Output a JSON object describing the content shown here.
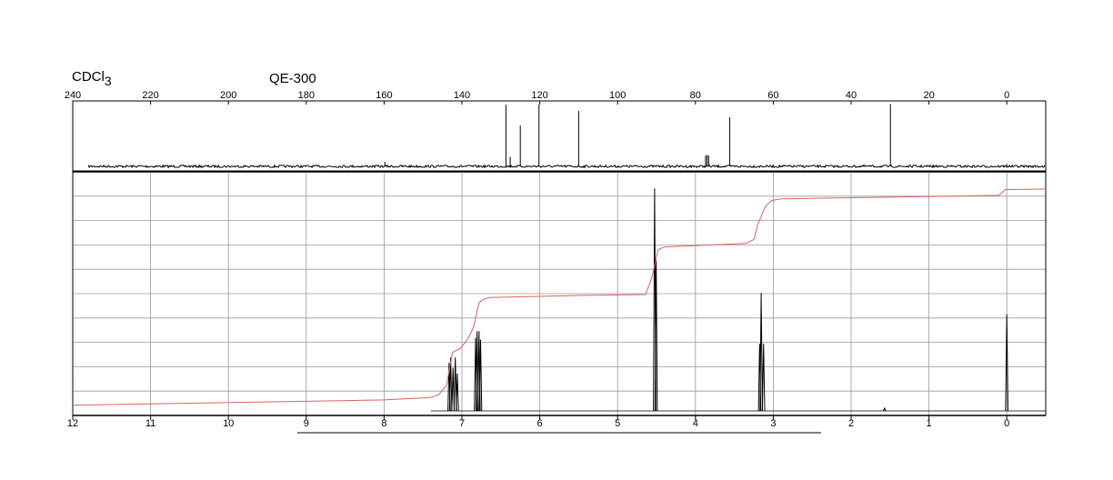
{
  "header": {
    "solvent_main": "CDCl",
    "solvent_sub": "3",
    "instrument": "QE-300"
  },
  "chart_data": [
    {
      "type": "line",
      "name": "13C NMR spectrum",
      "xlabel": "",
      "ylabel": "",
      "xlim": [
        240,
        -10
      ],
      "x_reversed": true,
      "ylim": [
        0,
        1
      ],
      "grid": false,
      "xticks": [
        240,
        220,
        200,
        180,
        160,
        140,
        120,
        100,
        80,
        60,
        40,
        20,
        0
      ],
      "xtick_labels": [
        "240",
        "220",
        "200",
        "180",
        "160",
        "140",
        "120",
        "100",
        "80",
        "60",
        "40",
        "20",
        "0"
      ],
      "baseline_start": 236,
      "peaks": [
        {
          "ppm": 128.7,
          "height": 0.97
        },
        {
          "ppm": 127.6,
          "height": 0.15
        },
        {
          "ppm": 125.0,
          "height": 0.64
        },
        {
          "ppm": 120.2,
          "height": 0.97
        },
        {
          "ppm": 110.0,
          "height": 0.87
        },
        {
          "ppm": 159.8,
          "height": 0.07
        },
        {
          "ppm": 77.4,
          "height": 0.17
        },
        {
          "ppm": 77.0,
          "height": 0.18
        },
        {
          "ppm": 76.6,
          "height": 0.17
        },
        {
          "ppm": 71.2,
          "height": 0.77
        },
        {
          "ppm": 29.9,
          "height": 0.98
        },
        {
          "ppm": 0.0,
          "height": 0.04
        }
      ]
    },
    {
      "type": "line",
      "name": "1H NMR spectrum",
      "xlabel": "",
      "ylabel": "",
      "xlim": [
        12,
        -0.5
      ],
      "x_reversed": true,
      "ylim": [
        0,
        1
      ],
      "grid": true,
      "xticks": [
        12,
        11,
        10,
        9,
        8,
        7,
        6,
        5,
        4,
        3,
        2,
        1,
        0
      ],
      "xtick_labels": [
        "12",
        "11",
        "10",
        "9",
        "8",
        "7",
        "6",
        "5",
        "4",
        "3",
        "2",
        "1",
        "0"
      ],
      "peaks": [
        {
          "ppm": 7.165,
          "height": 0.21
        },
        {
          "ppm": 7.145,
          "height": 0.232
        },
        {
          "ppm": 7.115,
          "height": 0.187
        },
        {
          "ppm": 7.085,
          "height": 0.232
        },
        {
          "ppm": 7.06,
          "height": 0.162
        },
        {
          "ppm": 6.825,
          "height": 0.318
        },
        {
          "ppm": 6.805,
          "height": 0.347
        },
        {
          "ppm": 6.78,
          "height": 0.347
        },
        {
          "ppm": 6.76,
          "height": 0.31
        },
        {
          "ppm": 4.525,
          "height": 0.967
        },
        {
          "ppm": 4.505,
          "height": 0.653
        },
        {
          "ppm": 3.175,
          "height": 0.292
        },
        {
          "ppm": 3.155,
          "height": 0.513
        },
        {
          "ppm": 3.125,
          "height": 0.292
        },
        {
          "ppm": 1.57,
          "height": 0.012
        },
        {
          "ppm": 0.0,
          "height": 0.42
        }
      ],
      "integral_curve": [
        [
          12.0,
          0.025
        ],
        [
          8.0,
          0.048
        ],
        [
          7.4,
          0.058
        ],
        [
          7.3,
          0.07
        ],
        [
          7.2,
          0.11
        ],
        [
          7.12,
          0.255
        ],
        [
          7.02,
          0.272
        ],
        [
          6.92,
          0.315
        ],
        [
          6.85,
          0.365
        ],
        [
          6.78,
          0.47
        ],
        [
          6.72,
          0.485
        ],
        [
          6.65,
          0.493
        ],
        [
          5.5,
          0.502
        ],
        [
          4.64,
          0.506
        ],
        [
          4.56,
          0.58
        ],
        [
          4.48,
          0.7
        ],
        [
          4.4,
          0.713
        ],
        [
          3.35,
          0.728
        ],
        [
          3.25,
          0.745
        ],
        [
          3.2,
          0.81
        ],
        [
          3.1,
          0.89
        ],
        [
          3.02,
          0.915
        ],
        [
          2.9,
          0.922
        ],
        [
          0.1,
          0.937
        ],
        [
          0.02,
          0.962
        ],
        [
          -0.5,
          0.965
        ]
      ],
      "integral_color": "#e06060"
    }
  ]
}
